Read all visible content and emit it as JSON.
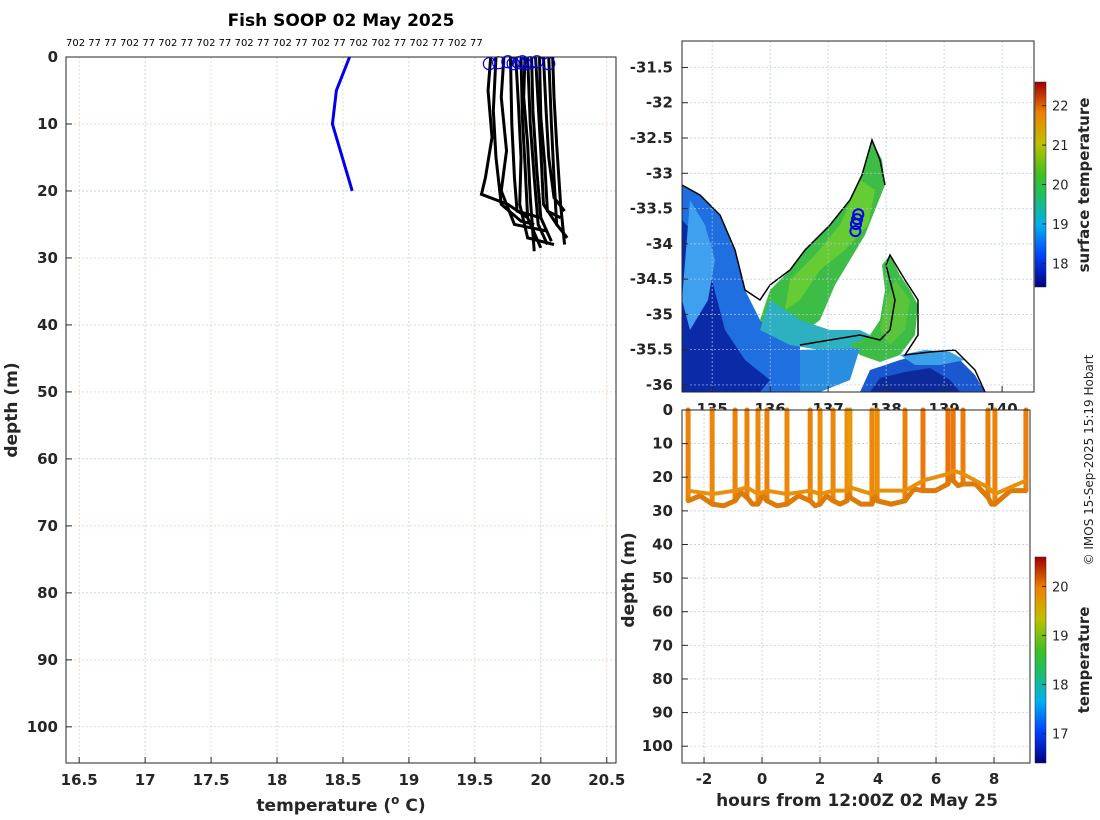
{
  "credit": "© IMOS 15-Sep-2025 15:19 Hobart",
  "chart_data": [
    {
      "type": "line",
      "title": "Fish SOOP 02 May 2025",
      "cast_labels": "702 77 77 702 77 702 77 702 77 702 77 702 77 702 77 702 702 77 702 77 702 77",
      "xlabel": "temperature (o C)",
      "xlabel_main": "temperature (",
      "xlabel_sup": "o",
      "xlabel_end": " C)",
      "ylabel": "depth (m)",
      "xlim": [
        16.4,
        20.57
      ],
      "ylim": [
        105.4,
        0
      ],
      "xticks": [
        "16.5",
        "17",
        "17.5",
        "18",
        "18.5",
        "19",
        "19.5",
        "20",
        "20.5"
      ],
      "yticks": [
        "0",
        "10",
        "20",
        "30",
        "40",
        "50",
        "60",
        "70",
        "80",
        "90",
        "100"
      ],
      "grid": true,
      "reference_profile": {
        "color": "#0000ee",
        "points": [
          [
            18.55,
            0
          ],
          [
            18.45,
            5
          ],
          [
            18.42,
            10
          ],
          [
            18.57,
            20
          ]
        ]
      },
      "profiles": [
        [
          [
            19.62,
            0
          ],
          [
            19.6,
            5
          ],
          [
            19.63,
            12
          ],
          [
            19.58,
            18
          ],
          [
            19.55,
            20.5
          ],
          [
            19.75,
            22
          ],
          [
            19.9,
            24
          ]
        ],
        [
          [
            19.66,
            0
          ],
          [
            19.64,
            8
          ],
          [
            19.66,
            15
          ],
          [
            19.7,
            22
          ],
          [
            19.85,
            24.5
          ],
          [
            19.95,
            25
          ]
        ],
        [
          [
            19.72,
            0
          ],
          [
            19.7,
            6
          ],
          [
            19.74,
            14
          ],
          [
            19.7,
            20
          ],
          [
            19.8,
            25
          ],
          [
            20.05,
            26
          ]
        ],
        [
          [
            19.77,
            0
          ],
          [
            19.78,
            10
          ],
          [
            19.8,
            18
          ],
          [
            19.82,
            23
          ],
          [
            20.0,
            24
          ]
        ],
        [
          [
            19.81,
            0
          ],
          [
            19.83,
            7
          ],
          [
            19.85,
            15
          ],
          [
            19.84,
            22
          ],
          [
            19.9,
            27
          ],
          [
            20.1,
            28
          ]
        ],
        [
          [
            19.85,
            0
          ],
          [
            19.86,
            9
          ],
          [
            19.88,
            16
          ],
          [
            19.9,
            24
          ],
          [
            20.0,
            28.5
          ]
        ],
        [
          [
            19.88,
            0
          ],
          [
            19.87,
            6
          ],
          [
            19.9,
            13
          ],
          [
            19.92,
            21
          ],
          [
            19.95,
            29
          ]
        ],
        [
          [
            19.9,
            0
          ],
          [
            19.92,
            10
          ],
          [
            19.95,
            18
          ],
          [
            19.98,
            25
          ],
          [
            20.05,
            28
          ]
        ],
        [
          [
            19.93,
            0
          ],
          [
            19.94,
            8
          ],
          [
            19.97,
            17
          ],
          [
            20.0,
            24
          ],
          [
            20.08,
            27.5
          ]
        ],
        [
          [
            19.96,
            0
          ],
          [
            19.98,
            7
          ],
          [
            20.0,
            14
          ],
          [
            20.02,
            22
          ],
          [
            20.12,
            25
          ]
        ],
        [
          [
            19.99,
            0
          ],
          [
            20.0,
            9
          ],
          [
            20.03,
            16
          ],
          [
            20.05,
            23
          ],
          [
            20.15,
            24
          ]
        ],
        [
          [
            20.02,
            0
          ],
          [
            20.04,
            8
          ],
          [
            20.06,
            15
          ],
          [
            20.1,
            21
          ],
          [
            20.18,
            23
          ]
        ],
        [
          [
            20.06,
            0
          ],
          [
            20.08,
            10
          ],
          [
            20.1,
            18
          ],
          [
            20.12,
            25
          ],
          [
            20.2,
            27
          ]
        ],
        [
          [
            20.09,
            0
          ],
          [
            20.1,
            6
          ],
          [
            20.12,
            13
          ],
          [
            20.15,
            22
          ],
          [
            20.18,
            28
          ]
        ]
      ],
      "surface_markers": [
        19.61,
        19.68,
        19.75,
        19.79,
        19.83,
        19.86,
        19.88,
        19.92,
        19.97,
        20.06
      ]
    },
    {
      "type": "heatmap",
      "xlim": [
        134.48,
        140.55
      ],
      "ylim": [
        -36.1,
        -31.125
      ],
      "xticks": [
        "135",
        "136",
        "137",
        "138",
        "139",
        "140"
      ],
      "yticks": [
        "-31.5",
        "-32",
        "-32.5",
        "-33",
        "-33.5",
        "-34",
        "-34.5",
        "-35",
        "-35.5",
        "-36"
      ],
      "colorbar": {
        "label": "surface temperature",
        "ticks": [
          "18",
          "19",
          "20",
          "21",
          "22"
        ],
        "range": [
          17.4,
          22.6
        ]
      },
      "glider_positions": [
        [
          137.52,
          -33.58
        ],
        [
          137.5,
          -33.65
        ],
        [
          137.48,
          -33.72
        ],
        [
          137.47,
          -33.82
        ]
      ]
    },
    {
      "type": "scatter",
      "xlabel": "hours from 12:00Z 02 May 25",
      "ylabel": "depth (m)",
      "xlim": [
        -2.76,
        9.24
      ],
      "ylim": [
        105,
        0
      ],
      "xticks": [
        "-2",
        "0",
        "2",
        "4",
        "6",
        "8"
      ],
      "yticks": [
        "0",
        "10",
        "20",
        "30",
        "40",
        "50",
        "60",
        "70",
        "80",
        "90",
        "100"
      ],
      "colorbar": {
        "label": "temperature",
        "ticks": [
          "17",
          "18",
          "19",
          "20"
        ],
        "range": [
          16.4,
          20.6
        ]
      },
      "cast_hours": [
        -2.55,
        -1.72,
        -0.93,
        -0.52,
        -0.14,
        0.17,
        0.86,
        1.66,
        2.0,
        2.45,
        2.93,
        3.03,
        3.79,
        3.97,
        4.93,
        5.55,
        6.41,
        6.59,
        6.93,
        7.79,
        8.03,
        9.1
      ],
      "cast_bottom_depths": [
        27,
        28,
        27,
        26,
        28,
        27,
        28,
        27,
        28,
        27,
        27,
        26,
        28,
        27,
        27,
        24,
        22,
        21,
        22,
        26,
        28,
        24
      ],
      "cast_temperatures": [
        19.8,
        19.75,
        19.8,
        19.8,
        19.75,
        19.8,
        19.75,
        19.8,
        19.7,
        19.75,
        19.7,
        19.6,
        19.75,
        19.7,
        19.8,
        19.9,
        19.95,
        19.9,
        19.85,
        19.85,
        19.8,
        19.85
      ]
    }
  ]
}
